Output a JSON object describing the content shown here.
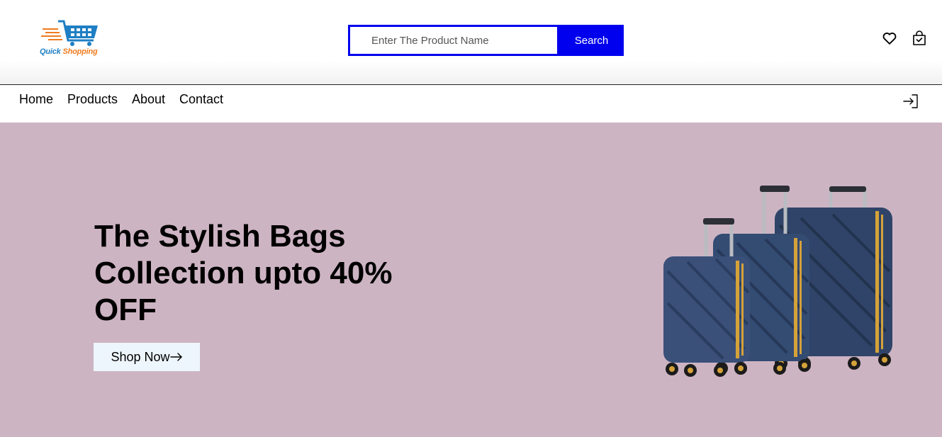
{
  "brand": {
    "logo_word1": "Quick",
    "logo_word2": "Shopping",
    "blue": "#1f7fc4",
    "orange": "#f07b1f"
  },
  "search": {
    "placeholder": "Enter The Product Name",
    "value": "",
    "button_label": "Search",
    "accent": "#0000ee"
  },
  "header_icons": {
    "wishlist": "heart-icon",
    "cart": "shopping-bag-icon"
  },
  "nav": {
    "items": [
      {
        "label": "Home"
      },
      {
        "label": "Products"
      },
      {
        "label": "About"
      },
      {
        "label": "Contact"
      }
    ],
    "login_icon": "login-icon"
  },
  "hero": {
    "title": "The Stylish Bags Collection upto 40% OFF",
    "button_label": "Shop Now",
    "button_icon": "arrow-right-icon",
    "background": "#cdb4c3",
    "image": "luggage-set-image"
  }
}
